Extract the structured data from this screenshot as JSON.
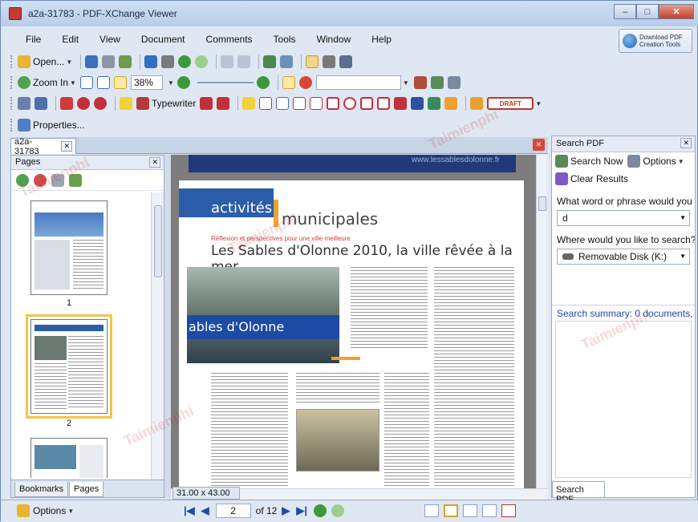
{
  "window": {
    "title": "a2a-31783 - PDF-XChange Viewer",
    "min": "–",
    "max": "□",
    "close": "✕"
  },
  "menu": [
    "File",
    "Edit",
    "View",
    "Document",
    "Comments",
    "Tools",
    "Window",
    "Help"
  ],
  "download_button": {
    "line1": "Download PDF",
    "line2": "Creation Tools"
  },
  "toolbar1": {
    "open_label": "Open..."
  },
  "toolbar2": {
    "zoom_in_label": "Zoom In",
    "zoom_value": "38%"
  },
  "toolbar3": {
    "typewriter_label": "Typewriter",
    "draft_stamp": "DRAFT"
  },
  "toolbar4": {
    "properties_label": "Properties..."
  },
  "doc_tab": {
    "label": "a2a-31783",
    "close": "✕"
  },
  "pages_panel": {
    "title": "Pages",
    "close": "✕",
    "thumbs": [
      {
        "label": "1"
      },
      {
        "label": "2"
      }
    ],
    "bottom_tabs": [
      "Bookmarks",
      "Pages"
    ]
  },
  "document": {
    "header_url": "www.lessablesdolonne.fr",
    "section_word1": "activités",
    "section_word2": "municipales",
    "kicker": "Réflexion et perspectives pour une ville meilleure",
    "headline": "Les Sables d'Olonne 2010, la ville rêvée à la mer",
    "photo_banner": "ables d'Olonne",
    "size_label": "31.00 x 43.00 cm"
  },
  "search_panel": {
    "title": "Search PDF",
    "close": "✕",
    "search_now": "Search Now",
    "options": "Options",
    "clear_results": "Clear Results",
    "word_label": "What word or phrase would you ...",
    "word_value": "d",
    "where_label": "Where would you like to search?",
    "where_value": "Removable Disk (K:)",
    "summary": "Search summary: 0 documents, ...",
    "bottom_tab": "Search PDF"
  },
  "statusbar": {
    "options_label": "Options",
    "page_current": "2",
    "page_total": "of 12"
  },
  "colors": {
    "accent_blue": "#2b5daa",
    "orange": "#f0a12e",
    "selection": "#f1c54a",
    "close_red": "#d8473a"
  },
  "watermark": "Taimienphi"
}
